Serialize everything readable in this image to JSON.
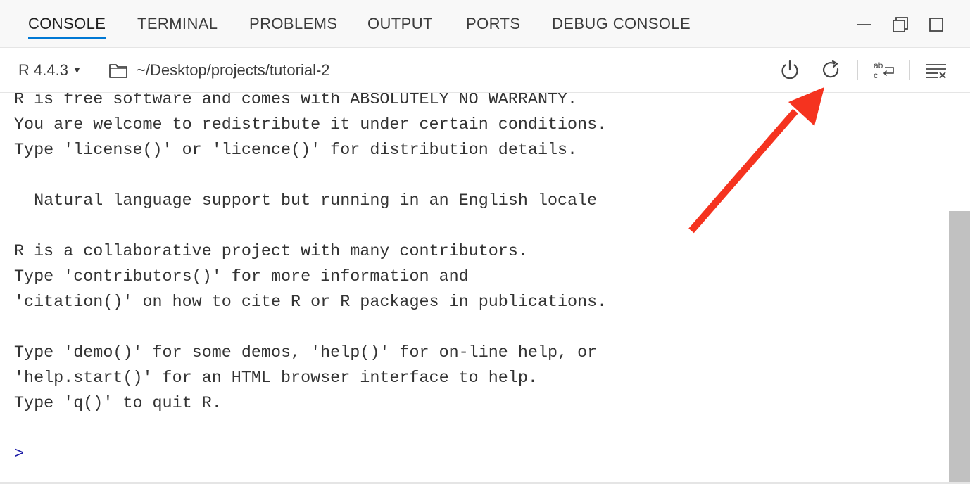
{
  "tabs": [
    {
      "label": "CONSOLE",
      "active": true
    },
    {
      "label": "TERMINAL",
      "active": false
    },
    {
      "label": "PROBLEMS",
      "active": false
    },
    {
      "label": "OUTPUT",
      "active": false
    },
    {
      "label": "PORTS",
      "active": false
    },
    {
      "label": "DEBUG CONSOLE",
      "active": false
    }
  ],
  "window_controls": {
    "icons": [
      "minimize-icon",
      "restore-icon",
      "maximize-icon"
    ]
  },
  "toolbar": {
    "interpreter": "R 4.4.3",
    "working_directory": "~/Desktop/projects/tutorial-2",
    "icons": [
      "power-icon",
      "restart-icon",
      "word-wrap-icon",
      "clear-console-icon"
    ]
  },
  "console": {
    "lines": [
      "R is free software and comes with ABSOLUTELY NO WARRANTY.",
      "You are welcome to redistribute it under certain conditions.",
      "Type 'license()' or 'licence()' for distribution details.",
      "",
      "  Natural language support but running in an English locale",
      "",
      "R is a collaborative project with many contributors.",
      "Type 'contributors()' for more information and",
      "'citation()' on how to cite R or R packages in publications.",
      "",
      "Type 'demo()' for some demos, 'help()' for on-line help, or",
      "'help.start()' for an HTML browser interface to help.",
      "Type 'q()' to quit R.",
      "",
      ""
    ],
    "prompt": ">"
  },
  "colors": {
    "active_tab_underline": "#0078d4",
    "prompt": "#1a1aa6",
    "annotation_arrow": "#f5331f",
    "scrollbar_thumb": "#c1c1c1"
  }
}
